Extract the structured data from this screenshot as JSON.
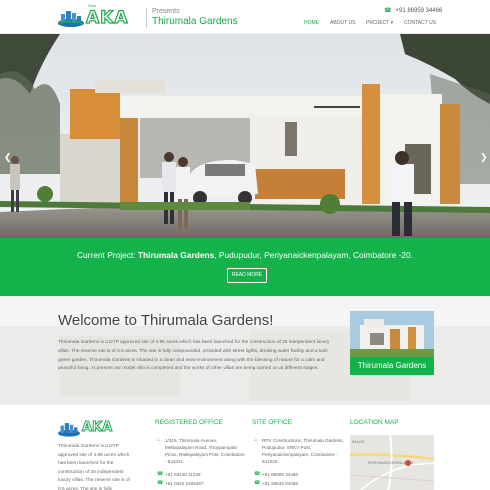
{
  "header": {
    "logo_text": "AKA",
    "logo_small": "Sree",
    "presents": "Presents",
    "project_name": "Thirumala Gardens",
    "phone": "+91 86959 34466",
    "nav": [
      {
        "label": "HOME",
        "active": true
      },
      {
        "label": "ABOUT US",
        "active": false
      },
      {
        "label": "PROJECT",
        "active": false
      },
      {
        "label": "CONTACT US",
        "active": false
      }
    ]
  },
  "hero": {
    "prev_icon": "chevron-left-icon",
    "next_icon": "chevron-right-icon"
  },
  "band": {
    "prefix": "Current Project: ",
    "project": "Thirumala Gardens",
    "location": ", Pudupudur, Periyanaickenpalayam, Coimbatore -20.",
    "read_more": "READ MORE"
  },
  "welcome": {
    "title": "Welcome to Thirumala Gardens!",
    "text": "Thirumala Gardens is a DTP approved site of 4.95 acres which has been launched for the construction of 25 independent luxury villas. The reserve site is of 0.5 acres. The site is fully compounded, provided with street lights, drinking water facility and a lush green garden. Thirumala Gardens is situated in a clean and neat environment along with the blessing of nature for a calm and peaceful living. At present our model villa is completed and the works of other villas are being carried on at different stages.",
    "card_caption": "Thirumala Gardens"
  },
  "footer": {
    "about": "Thirumala Gardens is a DTP approved site of 4.95 acres which has been launched for the construction of 25 independent luxury villas. The reserve site is of 0.5 acres. The site is fully compounded, provided with",
    "registered": {
      "heading": "REGISTERED OFFICE",
      "address": "1/315, Thirumala Avenue, Mettupalayam Road, Thoppampatti Pirivu, Rakkipalayam Post, Coimbatore - 641031.",
      "phone1": "+91 93448 11228",
      "phone2": "+91 0422 2465457"
    },
    "site": {
      "heading": "SITE OFFICE",
      "address": "RPV Constructions, Thirumala Gardens, Pudupudur, SRKV Post, Periyanaickenpalayam, Coimbatore - 641020.",
      "phone1": "+91 86959 34466",
      "phone2": "+91 93633 84466"
    },
    "map": {
      "heading": "LOCATION MAP",
      "labels": [
        "BALOR",
        "PERIYANAICKENPALAYAM"
      ]
    }
  }
}
